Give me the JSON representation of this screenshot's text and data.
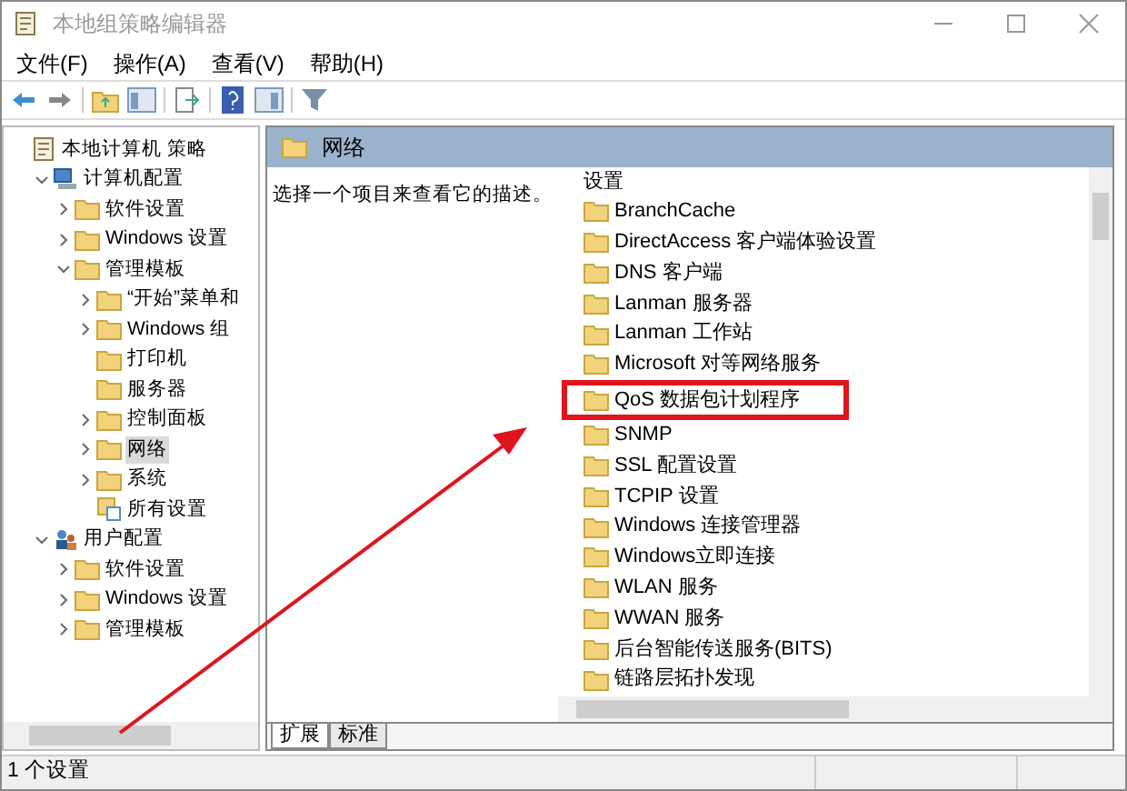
{
  "window": {
    "title": "本地组策略编辑器"
  },
  "menu": [
    "文件(F)",
    "操作(A)",
    "查看(V)",
    "帮助(H)"
  ],
  "tree": [
    {
      "label": "本地计算机 策略",
      "kind": "policy",
      "selected": false,
      "children": [
        {
          "label": "计算机配置",
          "kind": "computer",
          "expanded": true,
          "selected": false,
          "children": [
            {
              "label": "软件设置",
              "kind": "folder",
              "expanded": false,
              "selected": false
            },
            {
              "label": "Windows 设置",
              "kind": "folder",
              "expanded": false,
              "selected": false
            },
            {
              "label": "管理模板",
              "kind": "folder",
              "expanded": true,
              "selected": false,
              "children": [
                {
                  "label": "“开始”菜单和",
                  "kind": "folder",
                  "expanded": false,
                  "selected": false
                },
                {
                  "label": "Windows 组",
                  "kind": "folder",
                  "expanded": false,
                  "selected": false
                },
                {
                  "label": "打印机",
                  "kind": "folder",
                  "selected": false
                },
                {
                  "label": "服务器",
                  "kind": "folder",
                  "selected": false
                },
                {
                  "label": "控制面板",
                  "kind": "folder",
                  "expanded": false,
                  "selected": false
                },
                {
                  "label": "网络",
                  "kind": "folder",
                  "expanded": false,
                  "selected": true
                },
                {
                  "label": "系统",
                  "kind": "folder",
                  "expanded": false,
                  "selected": false
                },
                {
                  "label": "所有设置",
                  "kind": "settings",
                  "selected": false
                }
              ]
            }
          ]
        },
        {
          "label": "用户配置",
          "kind": "user",
          "expanded": true,
          "selected": false,
          "children": [
            {
              "label": "软件设置",
              "kind": "folder",
              "expanded": false,
              "selected": false
            },
            {
              "label": "Windows 设置",
              "kind": "folder",
              "expanded": false,
              "selected": false
            },
            {
              "label": "管理模板",
              "kind": "folder",
              "expanded": false,
              "selected": false
            }
          ]
        }
      ]
    }
  ],
  "detail": {
    "header": "网络",
    "description": "选择一个项目来查看它的描述。",
    "column_header": "设置"
  },
  "settings": {
    "items": [
      {
        "label": "BranchCache",
        "highlighted": false
      },
      {
        "label": "DirectAccess 客户端体验设置",
        "highlighted": false
      },
      {
        "label": "DNS 客户端",
        "highlighted": false
      },
      {
        "label": "Lanman 服务器",
        "highlighted": false
      },
      {
        "label": "Lanman 工作站",
        "highlighted": false
      },
      {
        "label": "Microsoft 对等网络服务",
        "highlighted": false
      },
      {
        "label": "QoS 数据包计划程序",
        "highlighted": true
      },
      {
        "label": "SNMP",
        "highlighted": false
      },
      {
        "label": "SSL 配置设置",
        "highlighted": false
      },
      {
        "label": "TCPIP 设置",
        "highlighted": false
      },
      {
        "label": "Windows 连接管理器",
        "highlighted": false
      },
      {
        "label": "Windows立即连接",
        "highlighted": false
      },
      {
        "label": "WLAN 服务",
        "highlighted": false
      },
      {
        "label": "WWAN 服务",
        "highlighted": false
      },
      {
        "label": "后台智能传送服务(BITS)",
        "highlighted": false
      },
      {
        "label": "链路层拓扑发现",
        "highlighted": false
      }
    ]
  },
  "tabs": [
    {
      "label": "扩展",
      "selected": true
    },
    {
      "label": "标准",
      "selected": false
    }
  ],
  "status_bar": "1 个设置"
}
